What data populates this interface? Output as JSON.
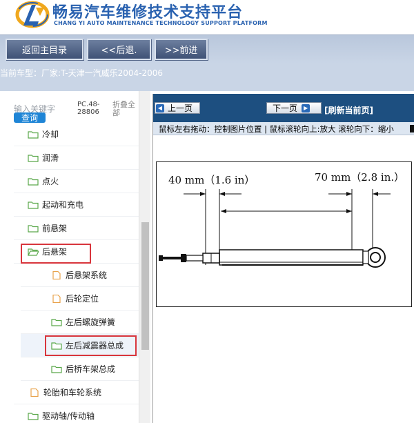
{
  "header": {
    "title_cn": "畅易汽车维修技术支持平台",
    "title_en": "CHANG YI AUTO MAINTENANCE TECHNOLOGY SUPPORT PLATFORM",
    "logo_icon": "cy-logo-icon"
  },
  "toolbar": {
    "home_label": "返回主目录",
    "back_label": "<<后退.",
    "forward_label": ">>前进"
  },
  "vehicle": {
    "label": "当前车型：",
    "value": "厂家:T-天津一汽威乐2004-2006"
  },
  "search": {
    "placeholder": "输入关键字",
    "button": "查询",
    "code": "PC.48-28806",
    "collapse_all": "折叠全部"
  },
  "tree": {
    "items": [
      {
        "label": "冷却",
        "icon": "folder-icon"
      },
      {
        "label": "润滑",
        "icon": "folder-icon"
      },
      {
        "label": "点火",
        "icon": "folder-icon"
      },
      {
        "label": "起动和充电",
        "icon": "folder-icon"
      },
      {
        "label": "前悬架",
        "icon": "folder-icon"
      },
      {
        "label": "后悬架",
        "icon": "folder-open-icon"
      },
      {
        "label": "后悬架系统",
        "icon": "file-icon"
      },
      {
        "label": "后轮定位",
        "icon": "file-icon"
      },
      {
        "label": "左后螺旋弹簧",
        "icon": "folder-icon"
      },
      {
        "label": "左后减震器总成",
        "icon": "folder-icon"
      },
      {
        "label": "后桥车架总成",
        "icon": "folder-icon"
      },
      {
        "label": "轮胎和车轮系统",
        "icon": "file-icon"
      },
      {
        "label": "驱动轴/传动轴",
        "icon": "folder-icon"
      }
    ]
  },
  "viewer": {
    "prev_label": "上一页",
    "next_label": "下一页",
    "refresh_label": "[刷新当前页]",
    "hint": "鼠标左右拖动：控制图片位置 | 鼠标滚轮向上:放大   滚轮向下：缩小",
    "diagram": {
      "dim_left": "40 mm（1.6 in）",
      "dim_right": "70 mm（2.8 in.）"
    }
  },
  "colors": {
    "brand_blue": "#2a62b0",
    "toolbar_button": "#4d5f82",
    "viewer_bar": "#1d4f80",
    "highlight_red": "#d8353c",
    "folder_green": "#5aa84a",
    "file_orange": "#e8a24a"
  }
}
